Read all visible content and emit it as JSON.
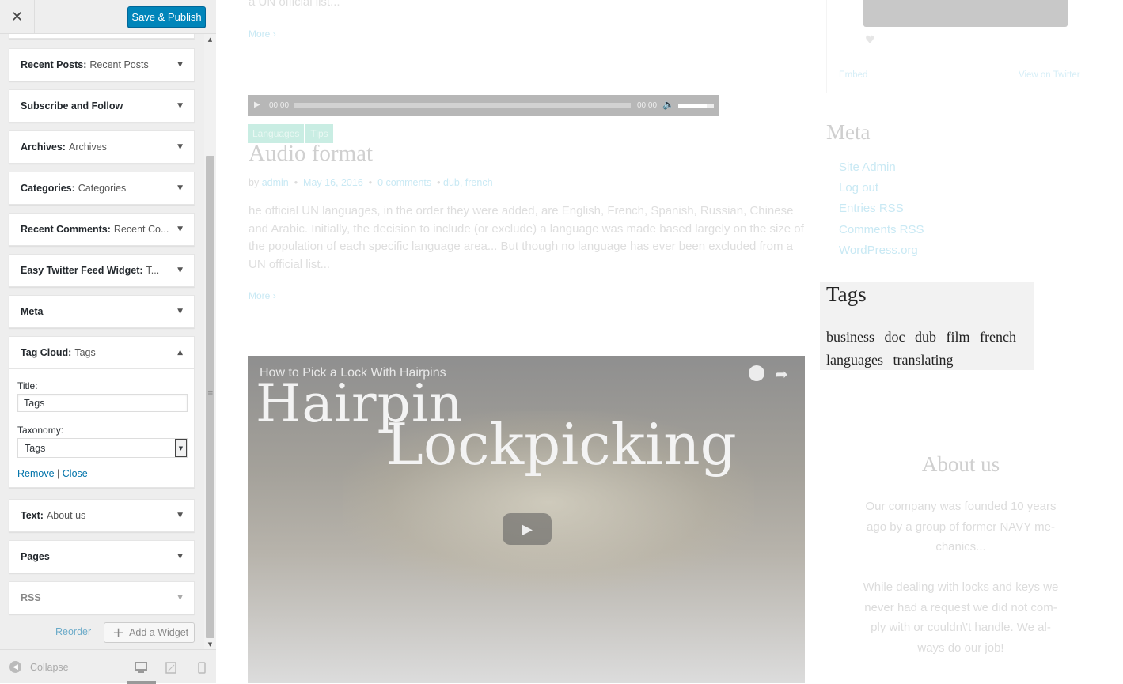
{
  "header": {
    "close_label": "✕",
    "save_label": "Save & Publish"
  },
  "widgets": [
    {
      "name": "Recent Posts:",
      "title": "Recent Posts",
      "expanded": false
    },
    {
      "name": "Subscribe and Follow",
      "title": "",
      "expanded": false
    },
    {
      "name": "Archives:",
      "title": "Archives",
      "expanded": false
    },
    {
      "name": "Categories:",
      "title": "Categories",
      "expanded": false
    },
    {
      "name": "Recent Comments:",
      "title": "Recent Co...",
      "expanded": false
    },
    {
      "name": "Easy Twitter Feed Widget:",
      "title": "T...",
      "expanded": false
    },
    {
      "name": "Meta",
      "title": "",
      "expanded": false
    },
    {
      "name": "Tag Cloud:",
      "title": "Tags",
      "expanded": true
    },
    {
      "name": "Text:",
      "title": "About us",
      "expanded": false
    },
    {
      "name": "Pages",
      "title": "",
      "expanded": false
    },
    {
      "name": "RSS",
      "title": "",
      "expanded": false
    }
  ],
  "tag_cloud_form": {
    "title_label": "Title:",
    "title_value": "Tags",
    "taxonomy_label": "Taxonomy:",
    "taxonomy_value": "Tags",
    "remove_label": "Remove",
    "separator": "|",
    "close_label": "Close"
  },
  "footer": {
    "reorder_label": "Reorder",
    "add_widget_label": "Add a Widget",
    "collapse_label": "Collapse"
  },
  "icons": {
    "arrow_down": "▼",
    "arrow_up": "▲",
    "plus": "+",
    "collapse": "◀",
    "desktop": "🖵",
    "tablet": "▭",
    "mobile": "▯"
  },
  "preview": {
    "excerpt_top": "a UN official list...",
    "more_label": "More",
    "more_arrow": "›",
    "audio": {
      "current": "00:00",
      "duration": "00:00"
    },
    "categories": [
      "Languages",
      "Tips"
    ],
    "post_title": "Audio format",
    "post_meta": {
      "by": "by",
      "author": "admin",
      "bullet": "•",
      "date": "May 16, 2016",
      "comments": "0 comments",
      "tags": "dub, french"
    },
    "post_excerpt": "he official UN languages, in the order they were added, are English, French, Spanish, Russian, Chinese and Arabic. Initially, the decision to include (or exclude) a language was made based largely on the size of the population of each specific language area... But though no language has ever been excluded from a UN official list...",
    "video": {
      "title": "How to Pick a Lock With Hairpins",
      "word1": "Hairpin",
      "word2": "Lockpicking"
    },
    "twitter": {
      "embed": "Embed",
      "view": "View on Twitter"
    },
    "meta_widget": {
      "title": "Meta",
      "items": [
        "Site Admin",
        "Log out",
        "Entries RSS",
        "Comments RSS",
        "WordPress.org"
      ]
    },
    "tags_widget": {
      "title": "Tags",
      "tags": [
        "business",
        "doc",
        "dub",
        "film",
        "french",
        "languages",
        "translating"
      ]
    },
    "about": {
      "title": "About us",
      "p1": "Our company was founded 10 years ago by a group of former NAVY me-chanics...",
      "p2": "While dealing with locks and keys we never had a request we did not com-ply with or couldn\\'t handle. We al-ways do our job!"
    }
  },
  "colors": {
    "primary_button": "#0085ba",
    "link": "#0073aa"
  }
}
